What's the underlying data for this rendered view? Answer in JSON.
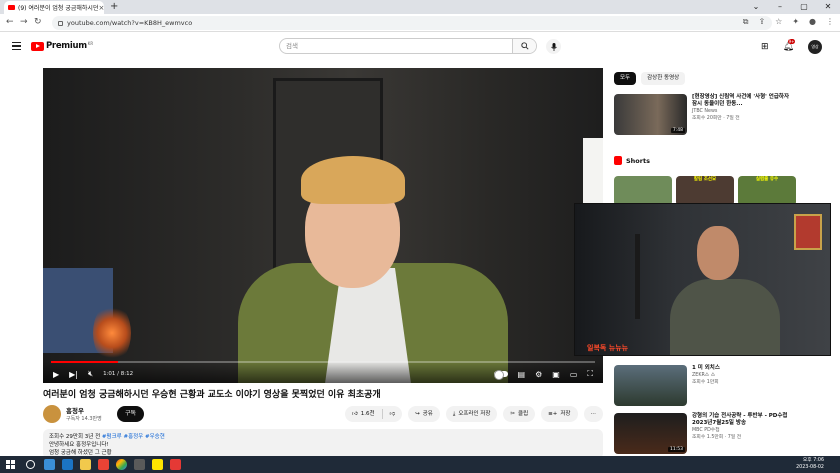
{
  "browser": {
    "tab_title": "(9) 여러분이 엄청 궁금해하시던",
    "url": "youtube.com/watch?v=KB8H_ewmvco"
  },
  "header": {
    "logo": "Premium",
    "region": "KR",
    "search_placeholder": "검색",
    "notification_count": "9+",
    "avatar_text": "영상"
  },
  "player": {
    "time": "1:01 / 8:12",
    "progress": 0.124
  },
  "video": {
    "title": "여러분이 엄청 궁금해하시던 우승현 근황과 교도소 이야기 영상을 못찍었던 이유 최초공개",
    "channel": "흥정우",
    "subscribers": "구독자 14.3만명",
    "subscribe_label": "구독",
    "likes": "1.6천",
    "share_label": "공유",
    "offline_label": "오프라인 저장",
    "clip_label": "클립",
    "save_label": "저장",
    "desc_stats": "조회수 29만회  3년 전",
    "desc_tags": "#펌크루 #홍정우 #우승현",
    "desc_line1": "안녕하세요 홍정우입니다!",
    "desc_line2": "엄청 궁금해 하셨던 그 근황"
  },
  "sidebar": {
    "chips": [
      "모두",
      "감상한 동영상"
    ],
    "first_video": {
      "title": "[현장영상] 신림역 사건에 '사형' 언급하자 잠시 동을이던 한동...",
      "channel": "JTBC News",
      "stats": "조회수 20회만 · 7일 전",
      "duration": "7:48"
    },
    "shorts_label": "Shorts",
    "shorts": [
      "",
      "칼림 조선묘",
      "실렴출 유수"
    ],
    "lower": [
      {
        "title": "1 미 외치스",
        "channel": "ZEKR스 스",
        "stats": "조회수 1만회",
        "duration": ""
      },
      {
        "title": "강형의 기습 전사공략 - 투반부 - PD수첩 2023년7월25일 방송",
        "channel": "MBC PD수첩",
        "stats": "조회수 1.5만회 · 7일 전",
        "duration": "11:53"
      }
    ]
  },
  "pip": {
    "caption": "일복독 뉴뉴뉴"
  },
  "taskbar": {
    "time": "오후 7:06",
    "date": "2023-08-02"
  }
}
